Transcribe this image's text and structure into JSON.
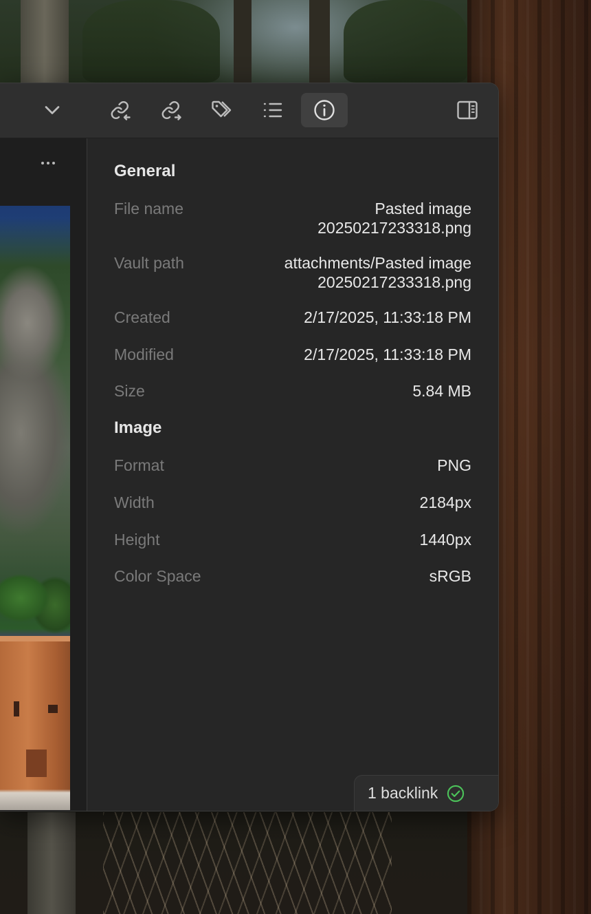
{
  "toolbar": {
    "buttons": [
      {
        "icon": "chevron-down-icon"
      },
      {
        "icon": "backlinks-icon"
      },
      {
        "icon": "outgoing-links-icon"
      },
      {
        "icon": "tags-icon"
      },
      {
        "icon": "outline-icon"
      },
      {
        "icon": "file-info-icon",
        "active": true
      },
      {
        "icon": "sidebar-toggle-icon"
      }
    ]
  },
  "inspector": {
    "general_title": "General",
    "file_name_label": "File name",
    "file_name_line1": "Pasted image",
    "file_name_line2": "20250217233318.png",
    "vault_path_label": "Vault path",
    "vault_path_line1": "attachments/Pasted image",
    "vault_path_line2": "20250217233318.png",
    "created_label": "Created",
    "created_value": "2/17/2025, 11:33:18 PM",
    "modified_label": "Modified",
    "modified_value": "2/17/2025, 11:33:18 PM",
    "size_label": "Size",
    "size_value": "5.84 MB",
    "image_title": "Image",
    "format_label": "Format",
    "format_value": "PNG",
    "width_label": "Width",
    "width_value": "2184px",
    "height_label": "Height",
    "height_value": "1440px",
    "color_space_label": "Color Space",
    "color_space_value": "sRGB"
  },
  "status": {
    "backlinks_text": "1 backlink",
    "check_color": "#4cc35a"
  },
  "colors": {
    "window_bg": "#262626",
    "titlebar_bg": "#2f2f2f",
    "active_button_bg": "#404040",
    "label_text": "#7a7a7a",
    "value_text": "#e8e8e8"
  }
}
